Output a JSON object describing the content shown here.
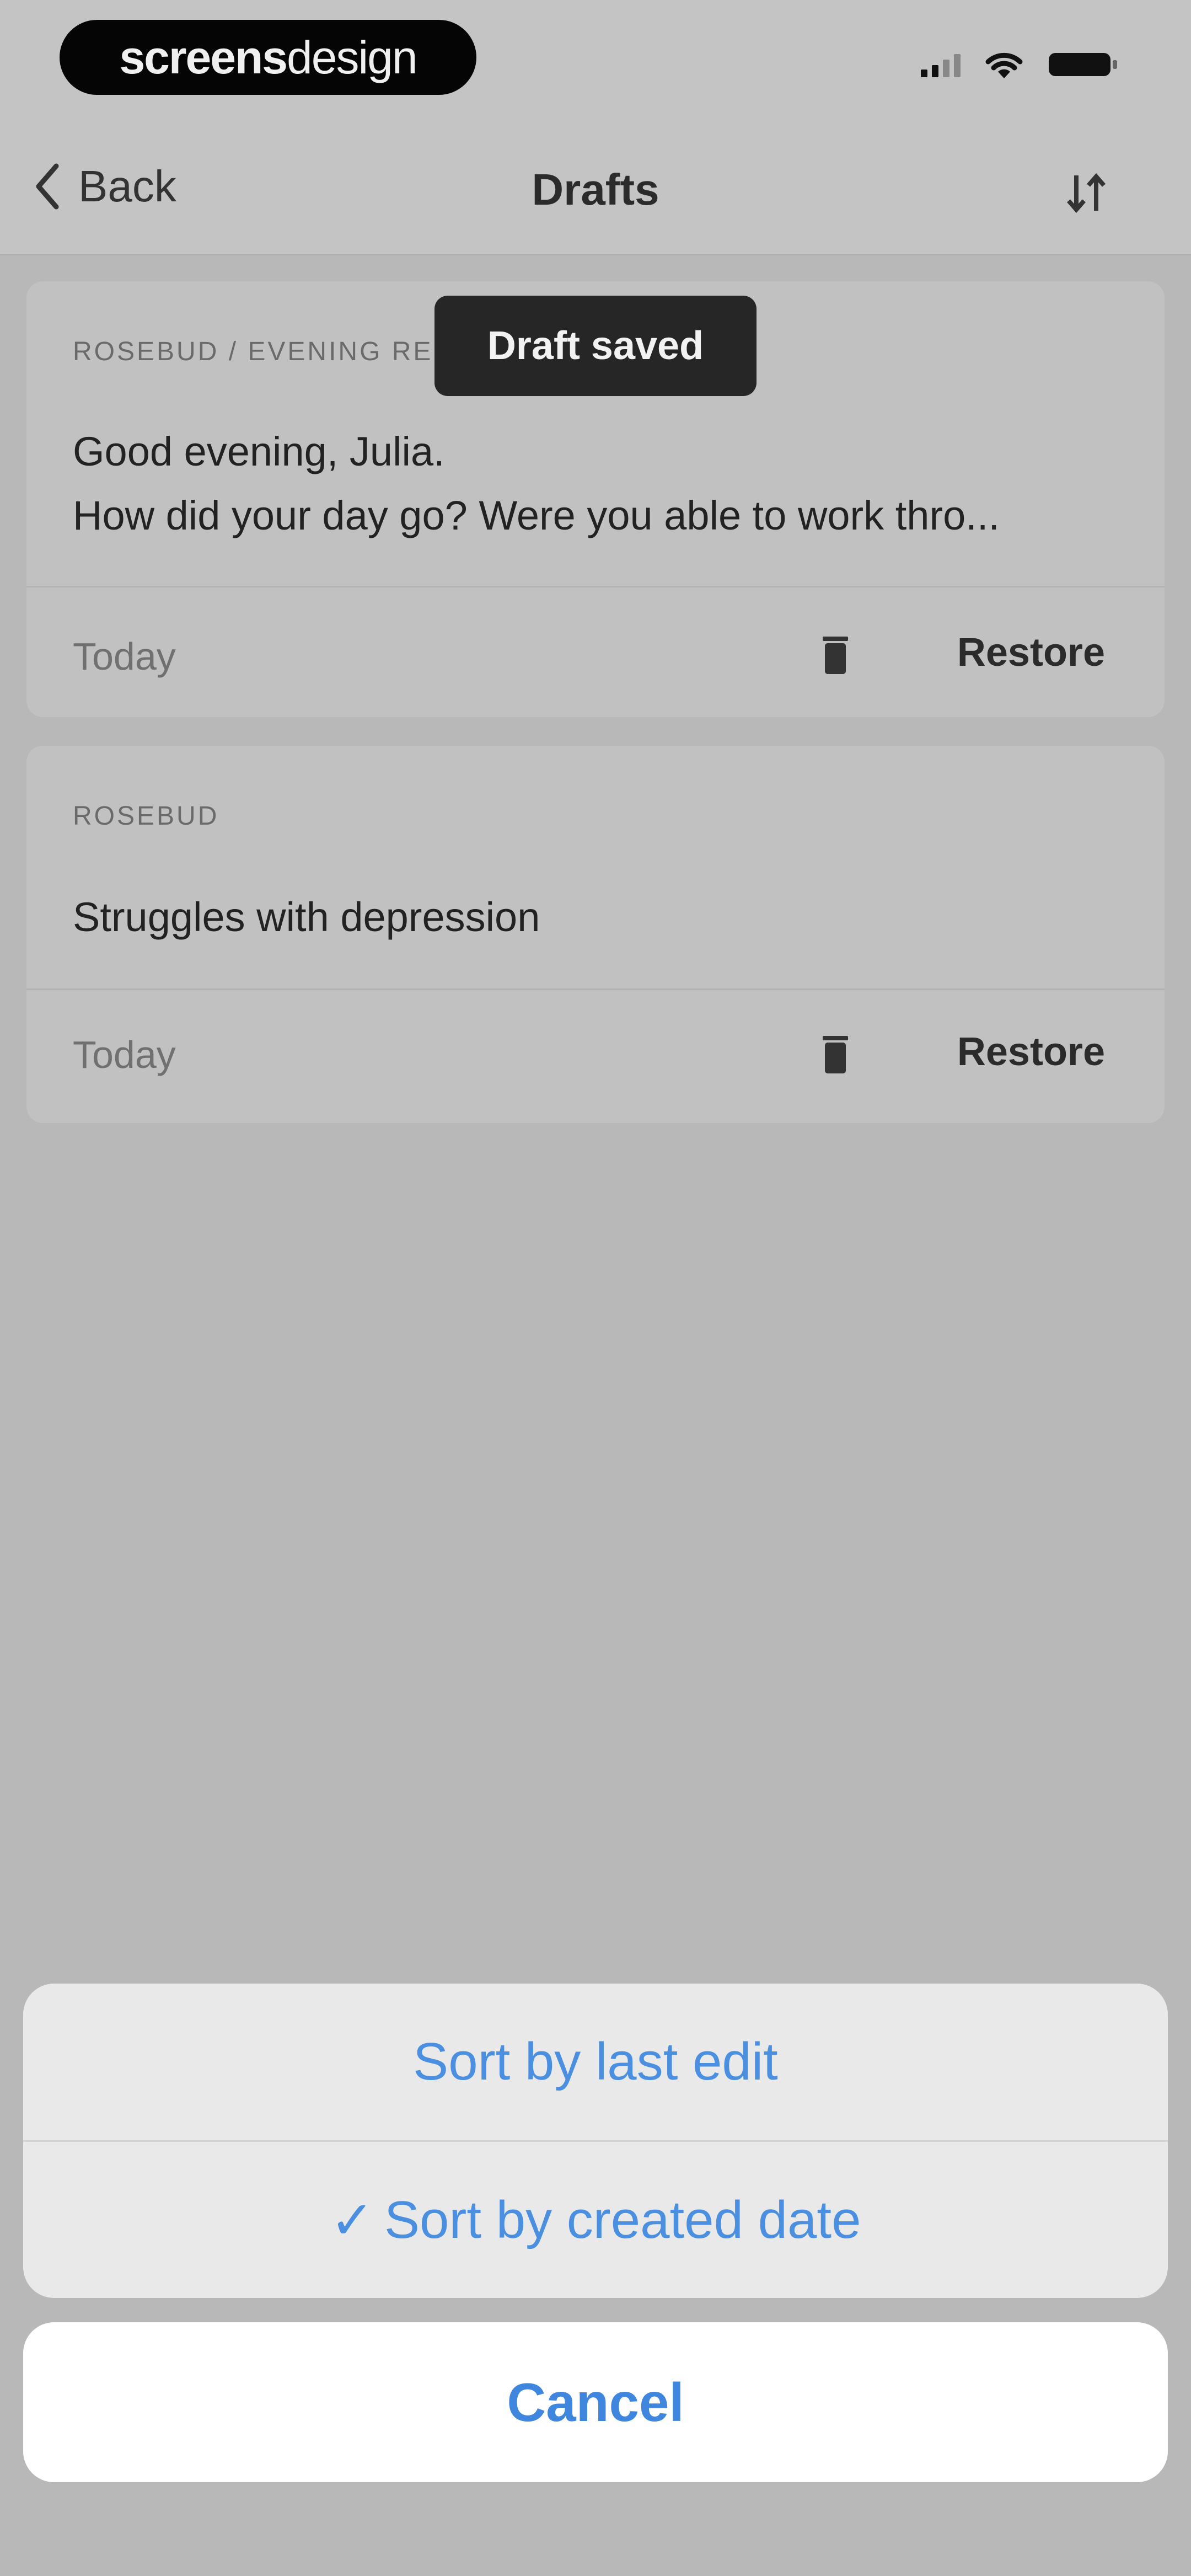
{
  "brand": {
    "bold": "screens",
    "light": "design"
  },
  "nav": {
    "back_label": "Back",
    "title": "Drafts",
    "sort_icon": "sort-arrows-icon"
  },
  "toast": {
    "message": "Draft saved"
  },
  "drafts": [
    {
      "meta": "ROSEBUD / EVENING RE",
      "line1": "Good evening, Julia.",
      "line2": "How did your day go? Were you able to work thro...",
      "date": "Today",
      "restore_label": "Restore"
    },
    {
      "meta": "ROSEBUD",
      "line1": "Struggles with depression",
      "date": "Today",
      "restore_label": "Restore"
    }
  ],
  "action_sheet": {
    "options": [
      {
        "label": "Sort by last edit",
        "selected": false
      },
      {
        "label": "Sort by created date",
        "selected": true
      }
    ],
    "check_mark": "✓",
    "cancel_label": "Cancel"
  },
  "colors": {
    "accent": "#4a8fe0",
    "toast_bg": "#262626"
  }
}
